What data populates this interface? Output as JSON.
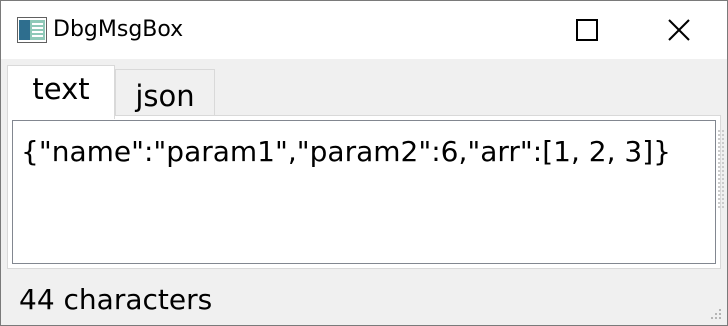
{
  "window": {
    "title": "DbgMsgBox",
    "icons": {
      "app": "app-window-icon",
      "maximize": "maximize-icon",
      "close": "close-icon"
    }
  },
  "tabs": [
    {
      "label": "text",
      "selected": true
    },
    {
      "label": "json",
      "selected": false
    }
  ],
  "editor": {
    "content": "{\"name\":\"param1\",\"param2\":6,\"arr\":[1, 2, 3]}"
  },
  "status": {
    "char_count_text": "44 characters"
  },
  "colors": {
    "titlebar_bg": "#ffffff",
    "window_bg": "#f0f0f0",
    "editor_border": "#828790"
  }
}
